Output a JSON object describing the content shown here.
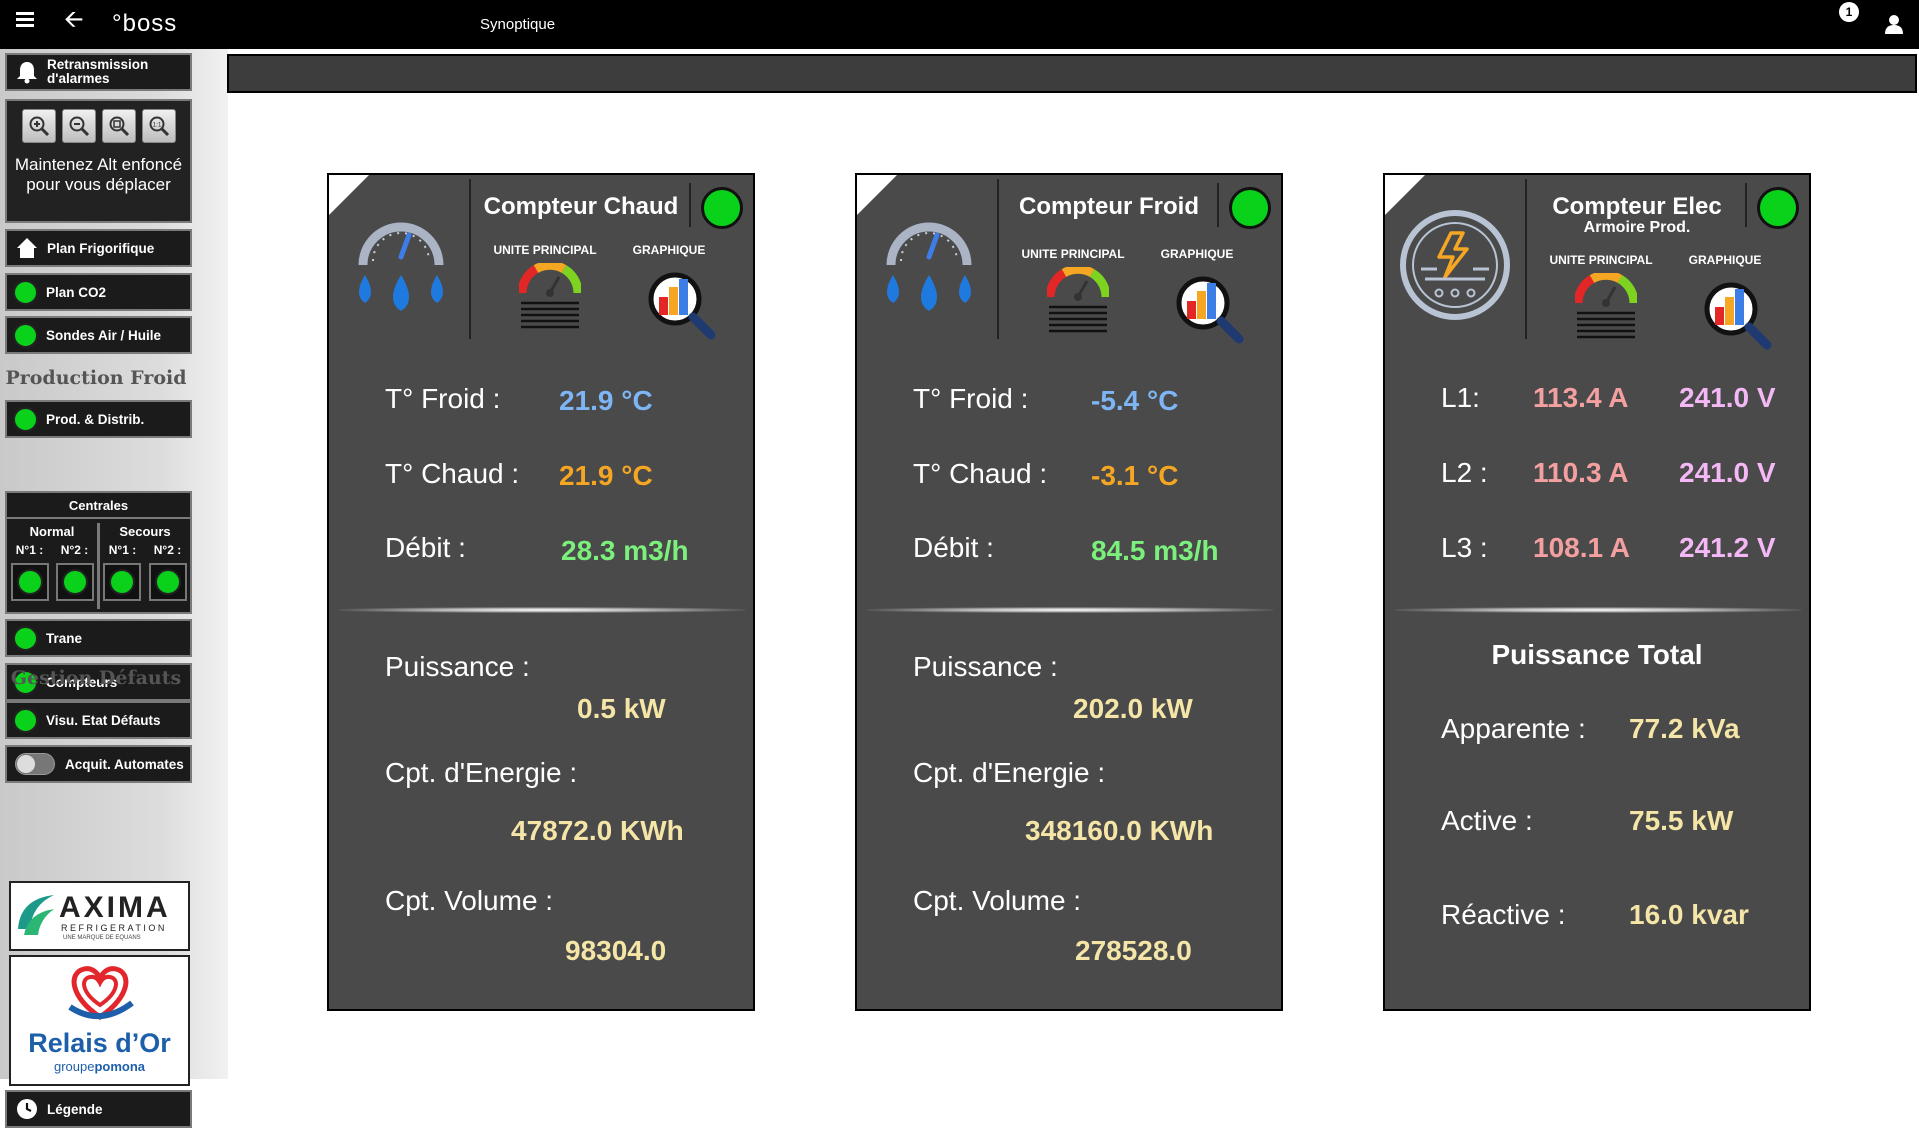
{
  "topbar": {
    "logo": "°boss",
    "title": "Synoptique",
    "notification_count": "1"
  },
  "sidebar": {
    "alarm_button": "Retransmission d'alarmes",
    "zoom_hint": "Maintenez Alt enfoncé pour vous déplacer",
    "plan_frigo": "Plan Frigorifique",
    "plan_co2": "Plan CO2",
    "sondes": "Sondes Air / Huile",
    "production_froid": "Production Froid",
    "prod_distrib": "Prod. & Distrib.",
    "centrales": {
      "title": "Centrales",
      "normal": "Normal",
      "secours": "Secours",
      "n1": "N°1 :",
      "n2": "N°2 :"
    },
    "trane": "Trane",
    "compteurs": "Compteurs",
    "gestion_defauts": "Gestion Défauts",
    "visu_defauts": "Visu. Etat Défauts",
    "acquit": "Acquit. Automates",
    "legende": "Légende",
    "logo_axima": {
      "name": "AXIMA",
      "sub": "REFRIGERATION",
      "tag": "UNE MARQUE DE EQUANS"
    },
    "logo_relais": {
      "name": "Relais d’Or",
      "group": "groupe",
      "group_brand": "pomona"
    }
  },
  "panels": {
    "common": {
      "unite": "UNITE PRINCIPAL",
      "graphique": "GRAPHIQUE"
    },
    "chaud": {
      "title": "Compteur Chaud",
      "t_froid_label": "T° Froid :",
      "t_froid": "21.9 °C",
      "t_chaud_label": "T° Chaud :",
      "t_chaud": "21.9 °C",
      "debit_label": "Débit :",
      "debit": "28.3 m3/h",
      "puissance_label": "Puissance :",
      "puissance": "0.5 kW",
      "energie_label": "Cpt. d'Energie :",
      "energie": "47872.0 KWh",
      "volume_label": "Cpt. Volume :",
      "volume": "98304.0"
    },
    "froid": {
      "title": "Compteur Froid",
      "t_froid_label": "T° Froid :",
      "t_froid": "-5.4 °C",
      "t_chaud_label": "T° Chaud :",
      "t_chaud": "-3.1 °C",
      "debit_label": "Débit :",
      "debit": "84.5 m3/h",
      "puissance_label": "Puissance :",
      "puissance": "202.0 kW",
      "energie_label": "Cpt. d'Energie :",
      "energie": "348160.0 KWh",
      "volume_label": "Cpt. Volume :",
      "volume": "278528.0"
    },
    "elec": {
      "title": "Compteur Elec",
      "subtitle": "Armoire Prod.",
      "l1_label": "L1:",
      "l1_a": "113.4 A",
      "l1_v": "241.0 V",
      "l2_label": "L2 :",
      "l2_a": "110.3 A",
      "l2_v": "241.0 V",
      "l3_label": "L3 :",
      "l3_a": "108.1 A",
      "l3_v": "241.2 V",
      "total_title": "Puissance Total",
      "apparente_label": "Apparente :",
      "apparente": "77.2 kVa",
      "active_label": "Active :",
      "active": "75.5 kW",
      "reactive_label": "Réactive :",
      "reactive": "16.0 kvar"
    }
  },
  "colors": {
    "status_green": "#0ad11a",
    "temp_blue": "#7eb6f5",
    "temp_orange": "#f5a623",
    "debit_green": "#7cf07c",
    "cream": "#f5e6a8",
    "current_pink": "#f5a0a0",
    "voltage_violet": "#f3b8f5"
  }
}
